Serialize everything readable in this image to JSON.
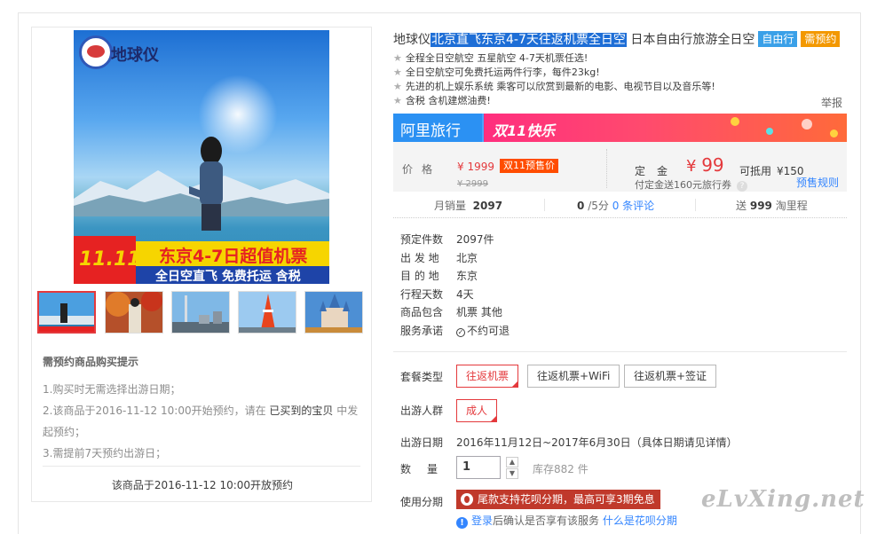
{
  "product": {
    "title_prefix": "地球仪",
    "title_highlight": "北京直飞东京4-7天往返机票全日空",
    "title_suffix": "日本自由行旅游全日空",
    "tags": [
      "自由行",
      "需预约"
    ],
    "features": [
      "全程全日空航空 五星航空 4-7天机票任选!",
      "全日空航空可免费托运两件行李，每件23kg!",
      "先进的机上娱乐系统 乘客可以欣赏到最新的电影、电视节目以及音乐等!",
      "含税 含机建燃油费!"
    ],
    "report_label": "举报"
  },
  "gallery": {
    "logo_text": "地球仪",
    "banner_line1": "东京4-7日超值机票",
    "banner_line2": "全日空直飞  免费托运  含税",
    "badge": "11.11",
    "thumbs": [
      "thumb-tokyo-girl",
      "thumb-kimono",
      "thumb-skytree",
      "thumb-tokyo-tower",
      "thumb-disney-castle"
    ]
  },
  "tips": {
    "title": "需预约商品购买提示",
    "line1": "1.购买时无需选择出游日期；",
    "line2_a": "2.该商品于2016-11-12 10:00开始预约，请在",
    "line2_b": "已买到的宝贝",
    "line2_c": "中发",
    "line2_d": "起预约；",
    "line3": "3.需提前7天预约出游日；",
    "footer": "该商品于2016-11-12 10:00开放预约"
  },
  "promo": {
    "left": "阿里旅行",
    "right": "双11快乐"
  },
  "price": {
    "label": "价格",
    "current": "¥ 1999",
    "badge": "双11预售价",
    "original": "¥ 2999",
    "deposit_label": "定金",
    "deposit_symbol": "¥",
    "deposit_value": "99",
    "offset_label": "可抵用",
    "offset_value": "¥150",
    "note": "付定金送160元旅行券",
    "help": "?",
    "rule_link": "预售规则"
  },
  "stats": {
    "monthly_label": "月销量",
    "monthly_value": "2097",
    "rating_value": "0",
    "rating_suffix": "/5分",
    "reviews_link": "0 条评论",
    "points_prefix": "送",
    "points_value": "999",
    "points_suffix": "淘里程"
  },
  "info": [
    {
      "k": "预定件数",
      "v": "2097件"
    },
    {
      "k": "出 发 地",
      "v": "北京"
    },
    {
      "k": "目 的 地",
      "v": "东京"
    },
    {
      "k": "行程天数",
      "v": "4天"
    },
    {
      "k": "商品包含",
      "v": "机票  其他"
    },
    {
      "k": "服务承诺",
      "v": "不约可退"
    }
  ],
  "package": {
    "label": "套餐类型",
    "options": [
      "往返机票",
      "往返机票+WiFi",
      "往返机票+签证"
    ]
  },
  "travelers": {
    "label": "出游人群",
    "options": [
      "成人"
    ]
  },
  "date": {
    "label": "出游日期",
    "value": "2016年11月12日~2017年6月30日（具体日期请见详情）"
  },
  "quantity": {
    "label": "数量",
    "value": "1",
    "stock": "库存882 件"
  },
  "installment": {
    "label": "使用分期",
    "button": "尾款支持花呗分期，最高可享3期免息",
    "login": "登录",
    "login_text": "后确认是否享有该服务",
    "help_link": "什么是花呗分期"
  },
  "watermark": "eLvXing.net",
  "colors": {
    "accent_red": "#e4393c",
    "link_blue": "#3385ff",
    "tag_blue": "#3aa0e8",
    "tag_orange": "#f39800"
  }
}
